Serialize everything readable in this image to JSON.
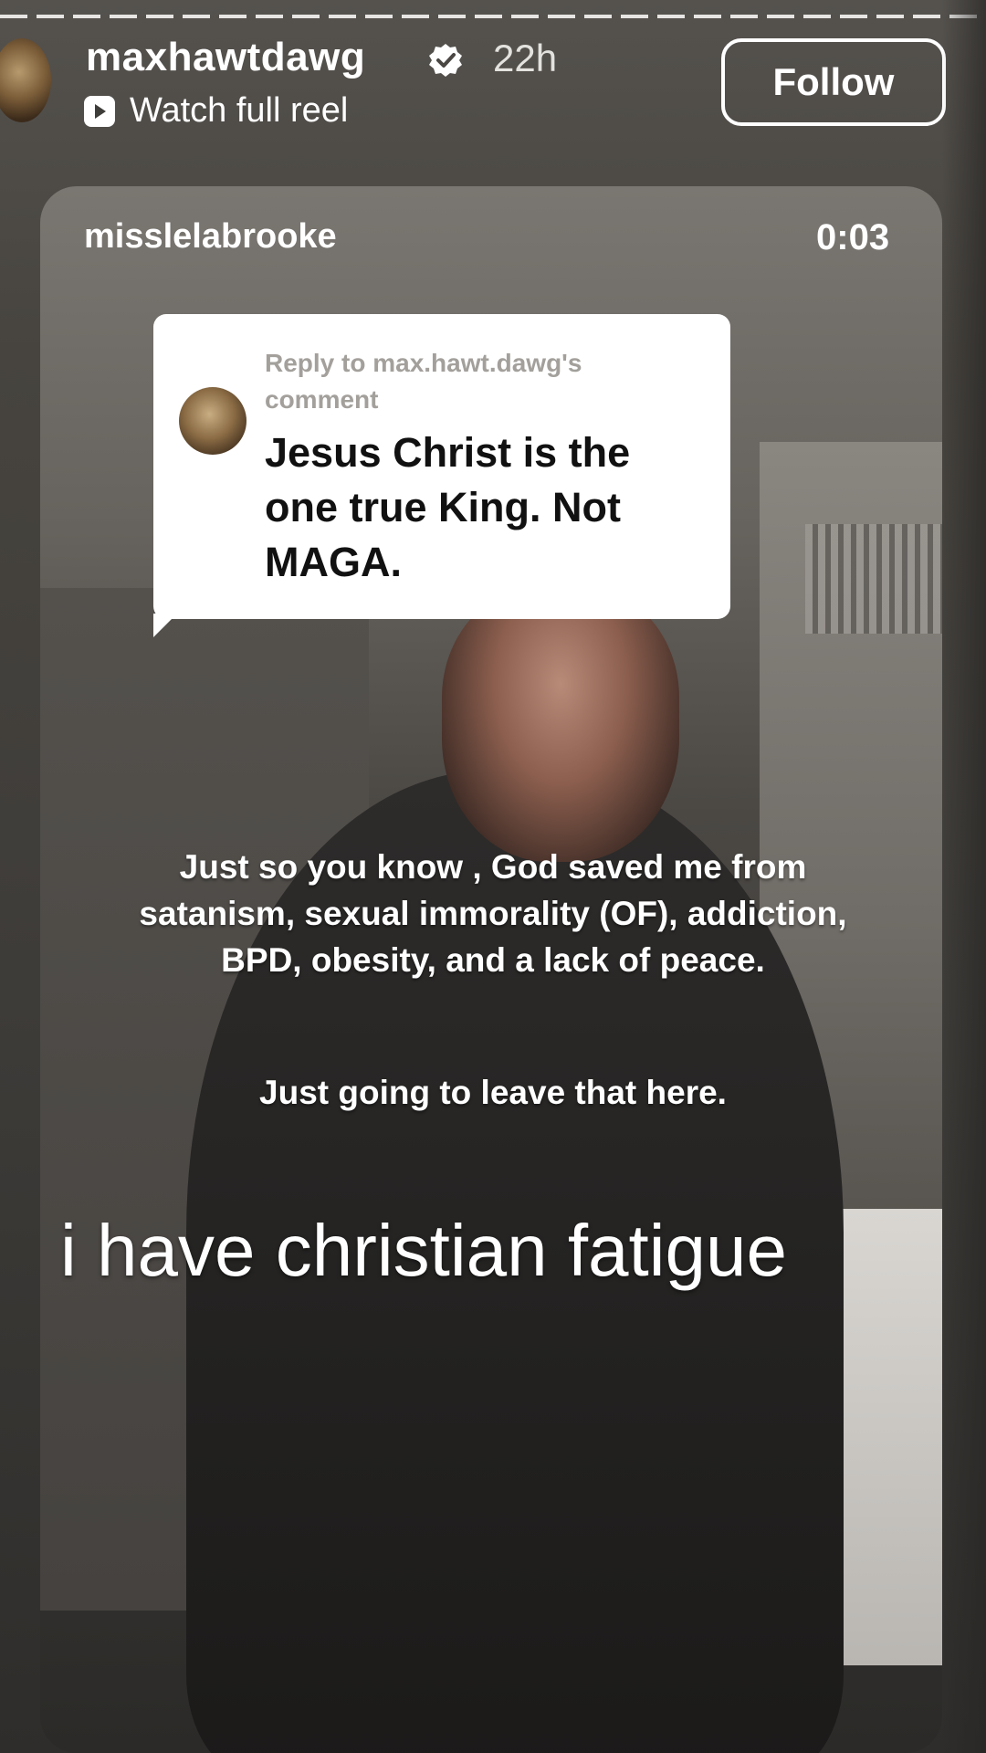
{
  "header": {
    "username": "maxhawtdawg",
    "timestamp": "22h",
    "reel_link_label": "Watch full reel",
    "follow_label": "Follow"
  },
  "video": {
    "creator": "misslelabrooke",
    "elapsed": "0:03",
    "reply": {
      "meta": "Reply to max.hawt.dawg's comment",
      "text": "Jesus Christ is the one true King. Not MAGA."
    },
    "overlay_main": "Just so you know , God saved me from satanism, sexual immorality (OF), addiction, BPD, obesity, and a lack of peace.",
    "overlay_secondary": "Just going to leave that here.",
    "caption": "i have christian fatigue"
  },
  "icons": {
    "verified": "verified-badge-icon",
    "reel": "play-icon"
  }
}
